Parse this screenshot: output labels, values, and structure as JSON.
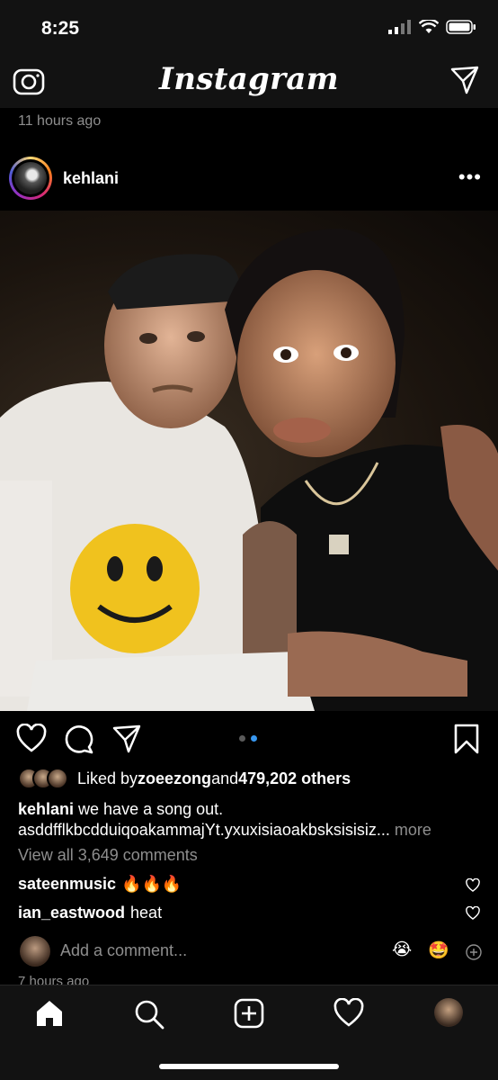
{
  "status_bar": {
    "time": "8:25"
  },
  "header": {
    "brand": "Instagram"
  },
  "feed": {
    "previous_post_time": "11 hours ago"
  },
  "post": {
    "username": "kehlani",
    "more_label": "•••",
    "image_alt": "Two people posing for a selfie at a dinner table",
    "liked_by_prefix": "Liked by ",
    "liked_by_user": "zoeezong",
    "liked_by_and": " and ",
    "liked_by_count": "479,202 others",
    "caption_user": "kehlani",
    "caption_line1": " we have a song out.",
    "caption_line2": "asddfflkbcdduiqoakammajYt.yxuxisiaoakbsksisisiz...",
    "caption_more": " more",
    "view_all_comments": "View all 3,649 comments",
    "comments": [
      {
        "user": "sateenmusic",
        "text": "🔥🔥🔥"
      },
      {
        "user": "ian_eastwood",
        "text": "heat"
      }
    ],
    "add_comment_placeholder": "Add a comment...",
    "quick_emojis": [
      "😭",
      "🤩"
    ],
    "timestamp": "7 hours ago",
    "carousel": {
      "total": 2,
      "active_index": 2
    }
  },
  "colors": {
    "background": "#000000",
    "bar": "#121212",
    "muted": "#8e8e8e",
    "carousel_active": "#3897f0",
    "carousel_inactive": "#5a5a5a"
  },
  "icons": [
    "camera-icon",
    "direct-message-icon",
    "heart-icon",
    "comment-icon",
    "share-icon",
    "bookmark-icon",
    "home-icon",
    "search-icon",
    "new-post-icon",
    "activity-icon"
  ]
}
